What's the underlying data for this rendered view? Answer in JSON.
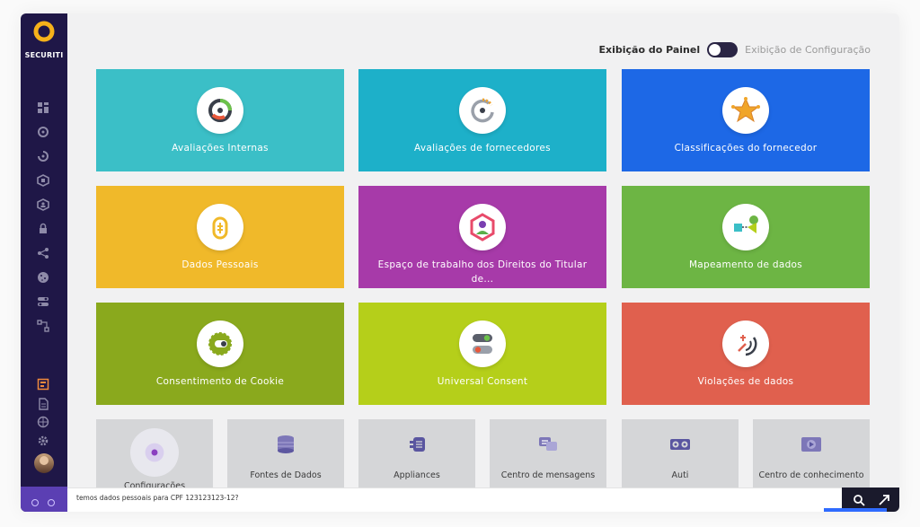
{
  "brand": {
    "name": "SECURITI"
  },
  "toggle": {
    "on_label": "Exibição do Painel",
    "off_label": "Exibição de Configuração"
  },
  "tiles": [
    {
      "label": "Avaliações Internas",
      "color": "#3bbfc7"
    },
    {
      "label": "Avaliações de fornecedores",
      "color": "#1db0c9"
    },
    {
      "label": "Classificações do fornecedor",
      "color": "#1d68e6"
    },
    {
      "label": "Dados Pessoais",
      "color": "#f0b92a"
    },
    {
      "label": "Espaço de trabalho dos Direitos do Titular de...",
      "color": "#a73aa9"
    },
    {
      "label": "Mapeamento de dados",
      "color": "#6db544"
    },
    {
      "label": "Consentimento de Cookie",
      "color": "#8aa91d"
    },
    {
      "label": "Universal Consent",
      "color": "#b5cf1a"
    },
    {
      "label": "Violações de dados",
      "color": "#e0604e"
    }
  ],
  "small_tiles": [
    {
      "label": "Configurações"
    },
    {
      "label": "Fontes de Dados"
    },
    {
      "label": "Appliances"
    },
    {
      "label": "Centro de mensagens"
    },
    {
      "label": "Auti"
    },
    {
      "label": "Centro de conhecimento"
    }
  ],
  "chat": {
    "value": "temos dados pessoais para CPF 123123123-12?"
  }
}
